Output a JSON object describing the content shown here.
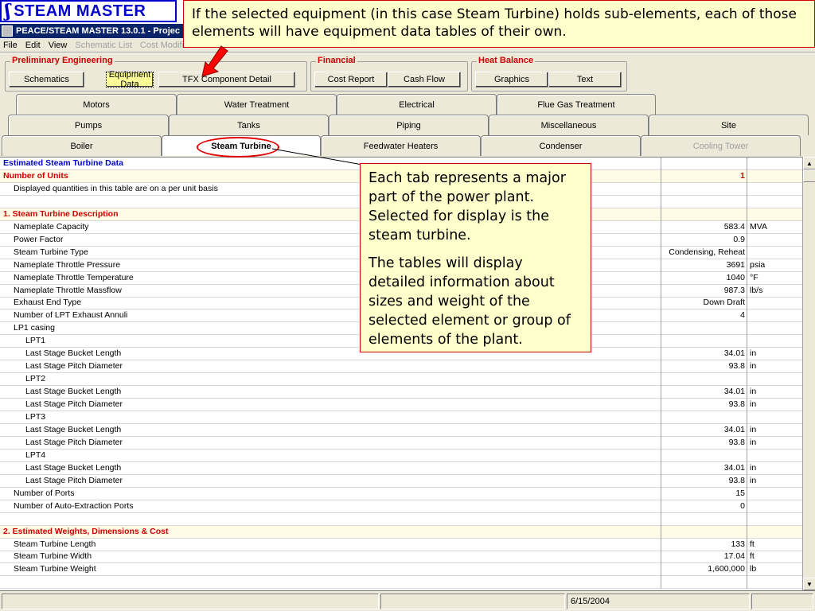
{
  "logo": {
    "mark": "ʃ",
    "text": "STEAM MASTER"
  },
  "window": {
    "title": "PEACE/STEAM MASTER 13.0.1 - Projec"
  },
  "menu": [
    {
      "label": "File",
      "enabled": true
    },
    {
      "label": "Edit",
      "enabled": true
    },
    {
      "label": "View",
      "enabled": true
    },
    {
      "label": "Schematic List",
      "enabled": false
    },
    {
      "label": "Cost Modifiers",
      "enabled": false
    }
  ],
  "groups": {
    "preliminary": {
      "title": "Preliminary Engineering",
      "buttons": [
        "Schematics",
        "Equipment Data",
        "TFX Component Detail"
      ]
    },
    "financial": {
      "title": "Financial",
      "buttons": [
        "Cost Report",
        "Cash Flow"
      ]
    },
    "heat_balance": {
      "title": "Heat Balance",
      "buttons": [
        "Graphics",
        "Text"
      ]
    }
  },
  "tabs": {
    "row1": [
      "Motors",
      "Water Treatment",
      "Electrical",
      "Flue Gas Treatment"
    ],
    "row2": [
      "Pumps",
      "Tanks",
      "Piping",
      "Miscellaneous",
      "Site"
    ],
    "row3": [
      "Boiler",
      "Steam Turbine",
      "Feedwater Heaters",
      "Condenser",
      "Cooling Tower"
    ]
  },
  "table": {
    "rows": [
      {
        "label": "Estimated Steam Turbine Data",
        "type": "header",
        "value": "",
        "unit": ""
      },
      {
        "label": "Number of Units",
        "type": "section",
        "value": "1",
        "unit": ""
      },
      {
        "label": "Displayed quantities in this table are on a per unit basis",
        "type": "l1",
        "value": "",
        "unit": ""
      },
      {
        "label": "",
        "type": "blank",
        "value": "",
        "unit": ""
      },
      {
        "label": "1. Steam Turbine Description",
        "type": "section",
        "value": "",
        "unit": ""
      },
      {
        "label": "Nameplate Capacity",
        "type": "l1",
        "value": "583.4",
        "unit": "MVA"
      },
      {
        "label": "Power Factor",
        "type": "l1",
        "value": "0.9",
        "unit": ""
      },
      {
        "label": "Steam Turbine Type",
        "type": "l1",
        "value": "Condensing, Reheat",
        "unit": ""
      },
      {
        "label": "Nameplate Throttle Pressure",
        "type": "l1",
        "value": "3691",
        "unit": "psia"
      },
      {
        "label": "Nameplate Throttle Temperature",
        "type": "l1",
        "value": "1040",
        "unit": "°F"
      },
      {
        "label": "Nameplate Throttle Massflow",
        "type": "l1",
        "value": "987.3",
        "unit": "lb/s"
      },
      {
        "label": "Exhaust End Type",
        "type": "l1",
        "value": "Down Draft",
        "unit": ""
      },
      {
        "label": "Number of LPT Exhaust Annuli",
        "type": "l1",
        "value": "4",
        "unit": ""
      },
      {
        "label": "LP1 casing",
        "type": "l1",
        "value": "",
        "unit": ""
      },
      {
        "label": "LPT1",
        "type": "l2",
        "value": "",
        "unit": ""
      },
      {
        "label": "Last Stage Bucket Length",
        "type": "l2",
        "value": "34.01",
        "unit": "in"
      },
      {
        "label": "Last Stage Pitch Diameter",
        "type": "l2",
        "value": "93.8",
        "unit": "in"
      },
      {
        "label": "LPT2",
        "type": "l2",
        "value": "",
        "unit": ""
      },
      {
        "label": "Last Stage Bucket Length",
        "type": "l2",
        "value": "34.01",
        "unit": "in"
      },
      {
        "label": "Last Stage Pitch Diameter",
        "type": "l2",
        "value": "93.8",
        "unit": "in"
      },
      {
        "label": "LPT3",
        "type": "l2",
        "value": "",
        "unit": ""
      },
      {
        "label": "Last Stage Bucket Length",
        "type": "l2",
        "value": "34.01",
        "unit": "in"
      },
      {
        "label": "Last Stage Pitch Diameter",
        "type": "l2",
        "value": "93.8",
        "unit": "in"
      },
      {
        "label": "LPT4",
        "type": "l2",
        "value": "",
        "unit": ""
      },
      {
        "label": "Last Stage Bucket Length",
        "type": "l2",
        "value": "34.01",
        "unit": "in"
      },
      {
        "label": "Last Stage Pitch Diameter",
        "type": "l2",
        "value": "93.8",
        "unit": "in"
      },
      {
        "label": "Number of Ports",
        "type": "l1",
        "value": "15",
        "unit": ""
      },
      {
        "label": "Number of Auto-Extraction Ports",
        "type": "l1",
        "value": "0",
        "unit": ""
      },
      {
        "label": "",
        "type": "blank",
        "value": "",
        "unit": ""
      },
      {
        "label": "2. Estimated Weights, Dimensions & Cost",
        "type": "section",
        "value": "",
        "unit": ""
      },
      {
        "label": "Steam Turbine Length",
        "type": "l1",
        "value": "133",
        "unit": "ft"
      },
      {
        "label": "Steam Turbine Width",
        "type": "l1",
        "value": "17.04",
        "unit": "ft"
      },
      {
        "label": "Steam Turbine Weight",
        "type": "l1",
        "value": "1,600,000",
        "unit": "lb"
      },
      {
        "label": "",
        "type": "blank",
        "value": "",
        "unit": ""
      }
    ]
  },
  "status": {
    "date": "6/15/2004"
  },
  "callouts": {
    "top": "If the selected equipment (in this case Steam Turbine) holds sub-elements, each of those elements will have equipment data tables of their own.",
    "side_p1": "Each tab represents a major part of the power plant. Selected for display is the steam turbine.",
    "side_p2": "The tables will display detailed information about sizes and weight of the selected element or group of elements of the plant."
  },
  "colors": {
    "title_bar": "#0a246a",
    "logo": "#0000cc",
    "section_text": "#cc0000",
    "callout_bg": "#ffffcc",
    "highlight_ring": "#e00000"
  }
}
